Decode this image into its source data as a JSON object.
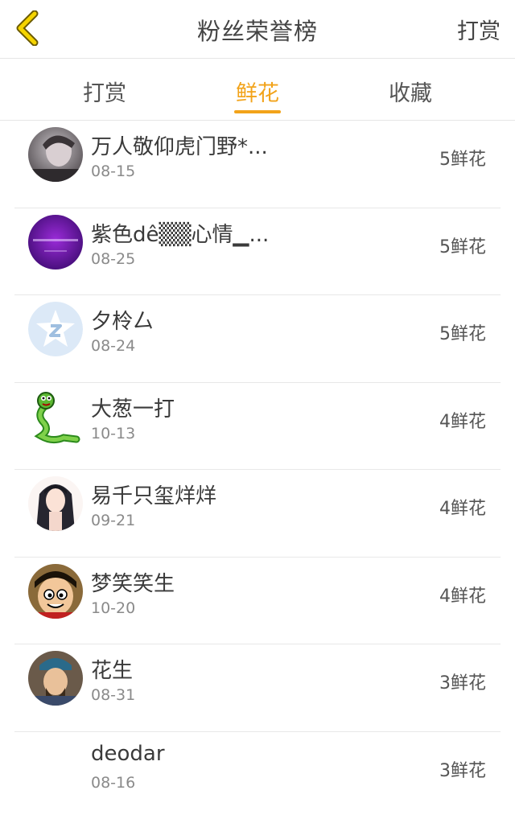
{
  "header": {
    "title": "粉丝荣誉榜",
    "action_label": "打赏"
  },
  "tabs": [
    {
      "label": "打赏"
    },
    {
      "label": "鲜花",
      "active": true
    },
    {
      "label": "收藏"
    }
  ],
  "colors": {
    "accent": "#f2a31a",
    "back_icon": "#e8b800"
  },
  "rows": [
    {
      "name": "万人敬仰虎门野*...",
      "date": "08-15",
      "count": "5鲜花",
      "avatar_icon": "avatar-photo-icon"
    },
    {
      "name": "紫色dê▒▒心情▁...",
      "date": "08-25",
      "count": "5鲜花",
      "avatar_icon": "avatar-purple-icon"
    },
    {
      "name": "夕柃厶",
      "date": "08-24",
      "count": "5鲜花",
      "avatar_icon": "qq-star-icon"
    },
    {
      "name": "大葱一打",
      "date": "10-13",
      "count": "4鲜花",
      "avatar_icon": "snake-icon"
    },
    {
      "name": "易千只玺烊烊",
      "date": "09-21",
      "count": "4鲜花",
      "avatar_icon": "anime-girl-icon"
    },
    {
      "name": "梦笑笑生",
      "date": "10-20",
      "count": "4鲜花",
      "avatar_icon": "luffy-icon"
    },
    {
      "name": "花生",
      "date": "08-31",
      "count": "3鲜花",
      "avatar_icon": "warrior-icon"
    },
    {
      "name": "deodar",
      "date": "08-16",
      "count": "3鲜花",
      "avatar_icon": ""
    }
  ]
}
